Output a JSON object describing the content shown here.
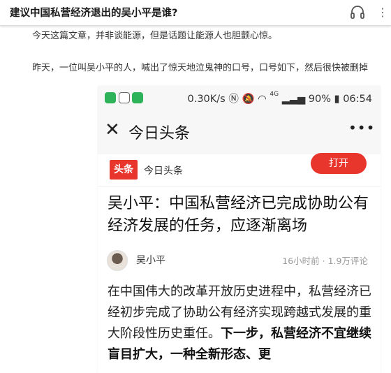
{
  "reader": {
    "title": "建议中国私营经济退出的吴小平是谁?",
    "paragraph_1": "今天这篇文章，并非谈能源，但是话题让能源人也胆颤心惊。",
    "paragraph_2": "昨天，一位叫吴小平的人，喊出了惊天地泣鬼神的口号，口号如下，然后很快被删掉"
  },
  "phone": {
    "status": {
      "network_speed": "0.30K/s",
      "battery": "90%",
      "time": "06:54",
      "network_type": "4G"
    },
    "navbar": {
      "close": "✕",
      "title": "今日头条",
      "more": "•••"
    },
    "appbar": {
      "logo": "头条",
      "name": "今日头条",
      "open_button": "打开"
    },
    "article": {
      "headline": "吴小平：中国私营经济已完成协助公有经济发展的任务，应逐渐离场",
      "author": "吴小平",
      "time_ago": "16小时前",
      "separator": "·",
      "comments": "1.9万评论",
      "body_normal": "在中国伟大的改革开放历史进程中，私营经济已经初步完成了协助公有经济实现跨越式发展的重大阶段性历史重任。",
      "body_bold": "下一步，私营经济不宜继续盲目扩大，一种全新形态、更"
    }
  }
}
